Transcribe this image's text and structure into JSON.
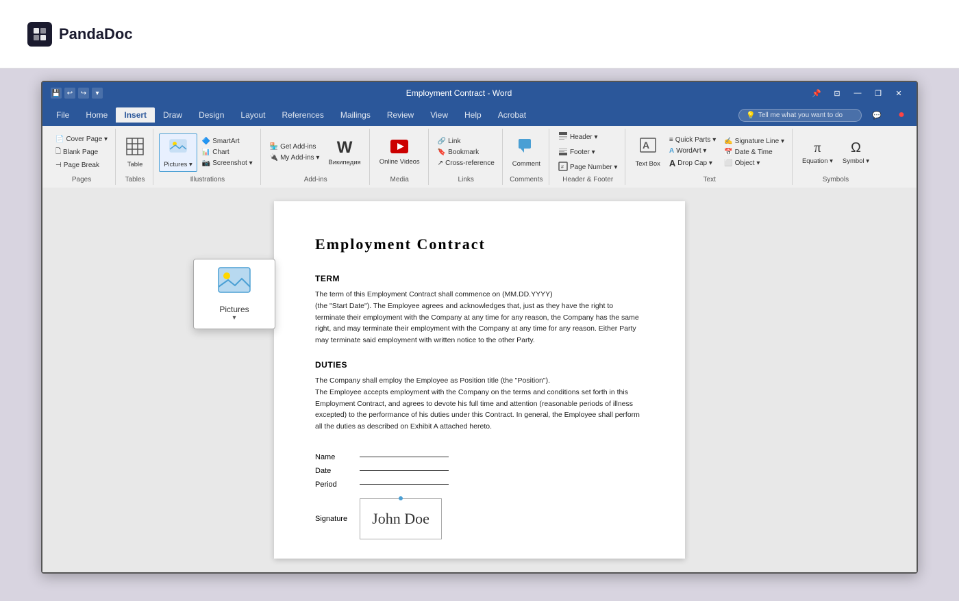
{
  "app": {
    "name": "PandaDoc",
    "logo_text": "PandaDoc",
    "logo_symbol": "pd"
  },
  "window": {
    "title": "Employment Contract - Word",
    "controls": {
      "minimize": "—",
      "restore": "❐",
      "close": "✕"
    }
  },
  "ribbon": {
    "tabs": [
      "File",
      "Home",
      "Insert",
      "Draw",
      "Design",
      "Layout",
      "References",
      "Mailings",
      "Review",
      "View",
      "Help",
      "Acrobat"
    ],
    "active_tab": "Insert",
    "search_placeholder": "Tell me what you want to do",
    "groups": {
      "pages": {
        "label": "Pages",
        "items": [
          "Cover Page",
          "Blank Page",
          "Page Break"
        ]
      },
      "tables": {
        "label": "Tables",
        "btn": "Table"
      },
      "illustrations": {
        "label": "Illustrations",
        "items": [
          "Pictures",
          "SmartArt",
          "Chart",
          "Screenshot"
        ]
      },
      "addins": {
        "label": "Add-ins",
        "items": [
          "Get Add-ins",
          "My Add-ins",
          "Wikipedia"
        ]
      },
      "media": {
        "label": "Media",
        "items": [
          "Online Videos"
        ]
      },
      "links": {
        "label": "Links",
        "items": [
          "Link",
          "Bookmark",
          "Cross-reference"
        ]
      },
      "comments": {
        "label": "Comments",
        "items": [
          "Comment"
        ]
      },
      "header_footer": {
        "label": "Header & Footer",
        "items": [
          "Header",
          "Footer",
          "Page Number"
        ]
      },
      "text_group": {
        "label": "Text",
        "items": [
          "Text Box",
          "Quick Parts",
          "WordArt",
          "Drop Cap",
          "Signature Line",
          "Date & Time",
          "Object"
        ]
      },
      "symbols": {
        "label": "Symbols",
        "items": [
          "Equation",
          "Symbol"
        ]
      }
    }
  },
  "pictures_dropdown": {
    "label": "Pictures",
    "arrow": "▾"
  },
  "document": {
    "title": "Employment  Contract",
    "sections": [
      {
        "heading": "TERM",
        "body": "The term of this Employment Contract shall commence on (MM.DD.YYYY)\n(the \"Start Date\"). The Employee agrees and acknowledges that, just as they have the right to terminate their employment with the Company at any time for any reason, the Company has the same right, and may terminate their employment with the Company at any time for any reason. Either Party may terminate said employment with written notice to the other Party."
      },
      {
        "heading": "DUTIES",
        "body": "The Company shall employ the Employee as Position title (the \"Position\").\nThe Employee accepts employment with the Company on the terms and conditions set forth in this Employment Contract, and agrees to devote his full time and attention (reasonable periods of illness excepted) to the performance of his duties under this Contract. In general, the Employee shall perform all the duties as described on Exhibit A attached hereto."
      }
    ],
    "signature": {
      "fields": [
        {
          "label": "Name"
        },
        {
          "label": "Date"
        },
        {
          "label": "Period"
        }
      ],
      "sig_label": "Signature",
      "sig_text": "John Doe"
    }
  }
}
